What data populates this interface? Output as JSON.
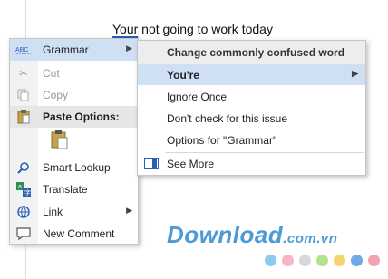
{
  "document": {
    "error_word": "Your",
    "rest_text": " not going to work today"
  },
  "context_menu": {
    "grammar": {
      "label": "Grammar",
      "icon": "abc-spelling-icon"
    },
    "cut": {
      "label": "Cut",
      "icon": "scissors-icon"
    },
    "copy": {
      "label": "Copy",
      "icon": "copy-icon"
    },
    "paste_options": {
      "label": "Paste Options:",
      "icon": "clipboard-icon"
    },
    "smart_lookup": {
      "label": "Smart Lookup",
      "icon": "smart-lookup-icon"
    },
    "translate": {
      "label": "Translate",
      "icon": "translate-icon"
    },
    "link": {
      "label": "Link",
      "icon": "link-icon"
    },
    "new_comment": {
      "label": "New Comment",
      "icon": "comment-icon"
    }
  },
  "grammar_submenu": {
    "header": "Change commonly confused word",
    "suggestion": "You're",
    "ignore_once": "Ignore Once",
    "dont_check": "Don't check for this issue",
    "options": "Options for \"Grammar\"",
    "see_more": "See More"
  },
  "watermark": {
    "text": "Download",
    "domain": ".com.vn",
    "dot_colors": [
      "#8ccbf0",
      "#f7b6c3",
      "#d8d8d8",
      "#b6e08a",
      "#f6d36b",
      "#6fa9e6",
      "#f5a3b0"
    ]
  },
  "colors": {
    "highlight": "#cfe0f5",
    "watermark": "#4c9bd7"
  }
}
